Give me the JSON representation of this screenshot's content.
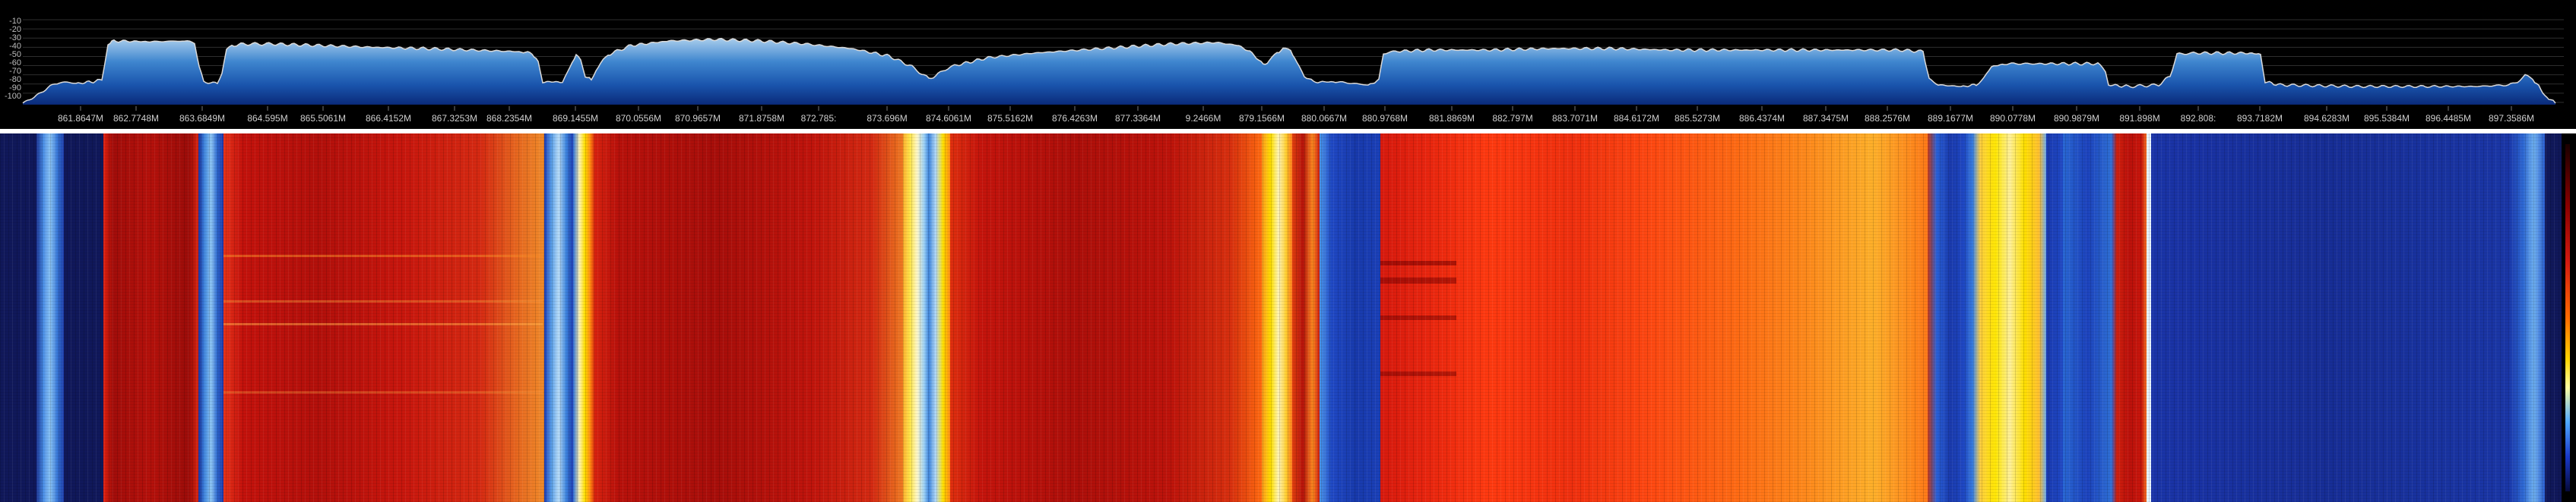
{
  "spectrum": {
    "db_scale": [
      "-10",
      "-20",
      "-30",
      "-40",
      "-50",
      "-60",
      "-70",
      "-80",
      "-90",
      "-100"
    ],
    "freq_labels": [
      "861.8647M",
      "862.7748M",
      "863.6849M",
      "864.595M",
      "865.5061M",
      "866.4152M",
      "867.3253M",
      "868.2354M",
      "869.1455M",
      "870.0556M",
      "870.9657M",
      "871.8758M",
      "872.785:",
      "873.696M",
      "874.6061M",
      "875.5162M",
      "876.4263M",
      "877.3364M",
      "9.2466M",
      "879.1566M",
      "880.0667M",
      "880.9768M",
      "881.8869M",
      "882.797M",
      "883.7071M",
      "884.6172M",
      "885.5273M",
      "886.4374M",
      "887.3475M",
      "888.2576M",
      "889.1677M",
      "890.0778M",
      "890.9879M",
      "891.898M",
      "892.808:",
      "893.7182M",
      "894.6283M",
      "895.5384M",
      "896.4485M",
      "897.3586M"
    ],
    "colors": {
      "trace": "#d9d9d9",
      "fill_top": "#7fb2dd",
      "fill_mid": "#1f62b8",
      "fill_bottom": "#0a2a7a",
      "grid": "#3a3a3a",
      "divider": "#ffffff"
    }
  },
  "waterfall": {
    "colors": {
      "noise": "#10185a",
      "weak": "#1e44c0",
      "edge": "#6fb0f0",
      "strong": "#c4100c",
      "hot": "#ff6a00",
      "peak": "#ffe600"
    }
  },
  "colorbar": {
    "min_color": "#060a3a",
    "max_color": "#8a0000"
  }
}
